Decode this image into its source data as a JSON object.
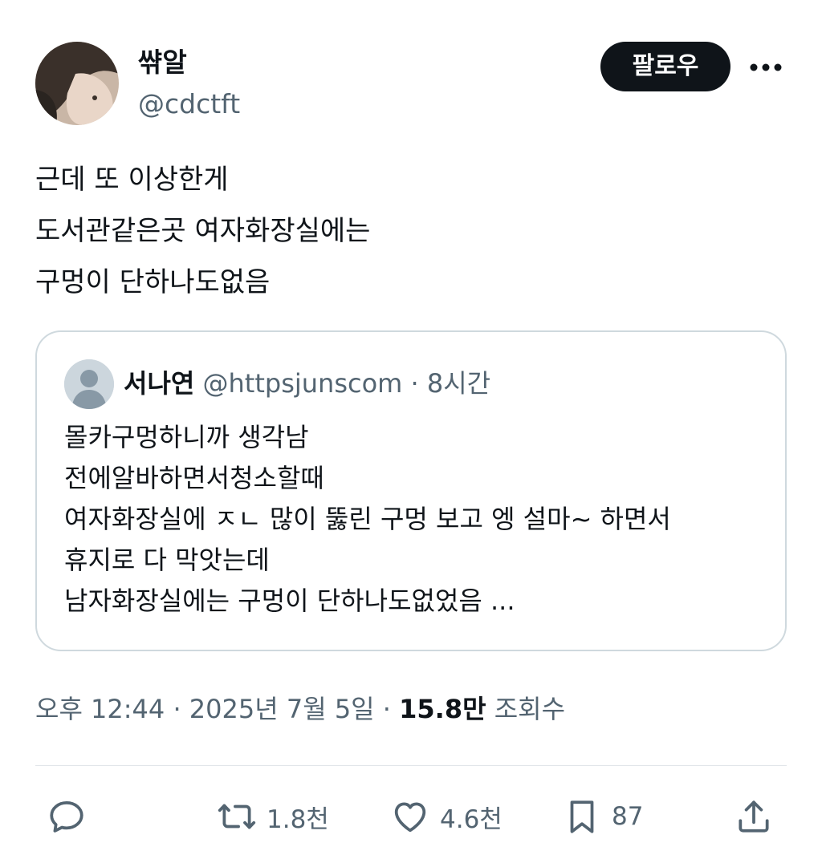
{
  "author": {
    "display_name": "쌲알",
    "handle": "@cdctft",
    "avatar": "profile-photo"
  },
  "follow_button": {
    "label": "팔로우"
  },
  "more_icon": "more-horizontal-icon",
  "tweet": {
    "lines": [
      "근데 또 이상한게",
      "도서관같은곳 여자화장실에는",
      "구멍이 단하나도없음"
    ]
  },
  "quote": {
    "author_name": "서나연",
    "author_handle": "@httpsjunscom",
    "separator": "·",
    "time": "8시간",
    "avatar": "default-avatar",
    "lines": [
      "몰카구멍하니까 생각남",
      "전에알바하면서청소할때",
      "여자화장실에 ㅈㄴ 많이 뚫린 구멍 보고 엥 설마~ 하면서",
      "휴지로 다 막앗는데",
      "남자화장실에는 구멍이 단하나도없었음 ..."
    ]
  },
  "meta": {
    "time": "오후 12:44",
    "sep1": "·",
    "date": "2025년 7월 5일",
    "sep2": "·",
    "views": "15.8만",
    "views_label": "조회수"
  },
  "actions": {
    "reply": {
      "icon": "reply-icon"
    },
    "retweet": {
      "icon": "retweet-icon",
      "count": "1.8천"
    },
    "like": {
      "icon": "heart-icon",
      "count": "4.6천"
    },
    "bookmark": {
      "icon": "bookmark-icon",
      "count": "87"
    },
    "share": {
      "icon": "share-icon"
    }
  },
  "colors": {
    "text": "#0f1419",
    "secondary": "#536471",
    "border": "#cfd9de",
    "button_bg": "#0f1419"
  }
}
